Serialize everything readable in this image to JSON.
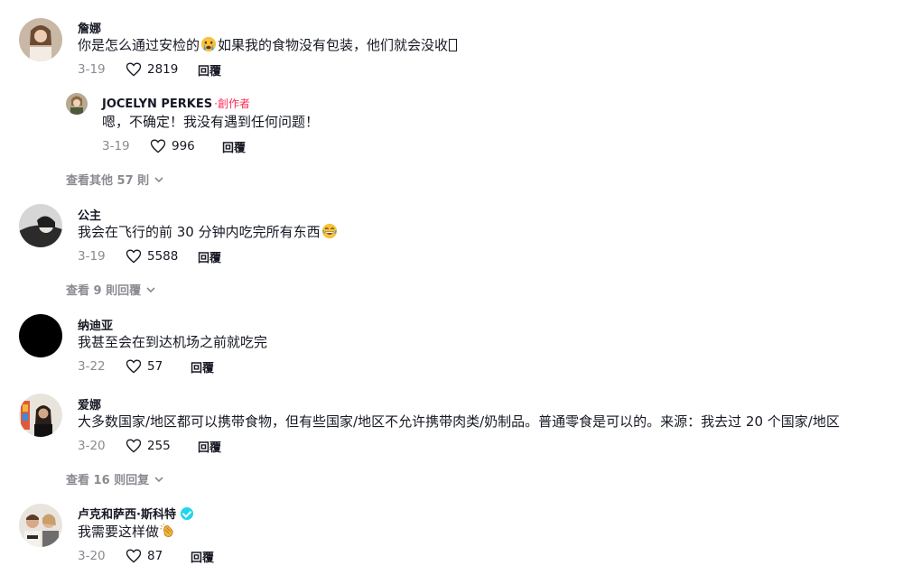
{
  "comments": [
    {
      "name": "詹娜",
      "text_before": "你是怎么通过安检的",
      "emoji1": "crying-face",
      "text_after": "如果我的食物没有包装，他们就会没收",
      "date": "3-19",
      "likes": "2819",
      "reply_label": "回覆"
    },
    {
      "name": "JOCELYN PERKES",
      "creator_tag": "·創作者",
      "text": "嗯，不确定！我没有遇到任何问题！",
      "date": "3-19",
      "likes": "996",
      "reply_label": "回覆"
    },
    {
      "name": "公主",
      "text": "我会在飞行的前 30 分钟内吃完所有东西",
      "emoji": "laughing-face",
      "date": "3-19",
      "likes": "5588",
      "reply_label": "回覆"
    },
    {
      "name": "纳迪亚",
      "text": "我甚至会在到达机场之前就吃完",
      "date": "3-22",
      "likes": "57",
      "reply_label": "回覆"
    },
    {
      "name": "爱娜",
      "text": "大多数国家/地区都可以携带食物，但有些国家/地区不允许携带肉类/奶制品。普通零食是可以的。来源：我去过 20 个国家/地区",
      "date": "3-20",
      "likes": "255",
      "reply_label": "回覆"
    },
    {
      "name": "卢克和萨西·斯科特",
      "text": "我需要这样做",
      "emoji": "clapping-hands",
      "date": "3-20",
      "likes": "87",
      "reply_label": "回覆"
    }
  ],
  "view_more": [
    {
      "label": "查看其他 57 則"
    },
    {
      "label": "查看 9 則回覆"
    },
    {
      "label": "查看 16 则回复"
    }
  ],
  "colors": {
    "text": "#161823",
    "secondary": "#8a8b91",
    "creator": "#fe2c55",
    "verified": "#20d5ec"
  }
}
